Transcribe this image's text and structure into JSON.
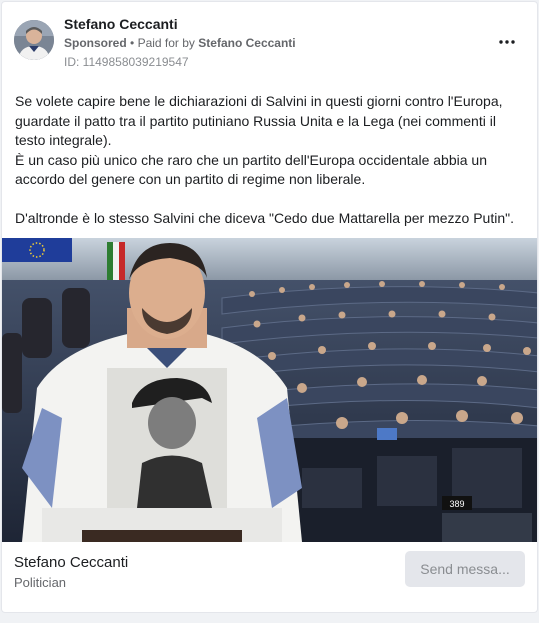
{
  "post": {
    "page_name": "Stefano Ceccanti",
    "sponsored": "Sponsored",
    "separator": "•",
    "paid_for_by_prefix": "Paid for by",
    "paid_for_by_name": "Stefano Ceccanti",
    "ad_id": "ID: 1149858039219547",
    "more_icon": "more-horizontal-icon",
    "body": [
      "Se volete capire bene le dichiarazioni di Salvini in questi giorni contro l'Europa, guardate il patto tra il partito putiniano Russia Unita e la Lega (nei commenti il testo integrale).",
      "È un caso più unico che raro che un partito dell'Europa occidentale abbia un accordo del genere con un partito di regime non liberale.",
      "D'altronde è lo stesso Salvini che diceva \"Cedo due Mattarella per mezzo Putin\"."
    ],
    "photo_seat_number": "389"
  },
  "footer": {
    "name": "Stefano Ceccanti",
    "role": "Politician",
    "send_button_label": "Send messa..."
  },
  "colors": {
    "card_bg": "#ffffff",
    "page_bg": "#f0f2f5",
    "text_primary": "#1c1e21",
    "text_secondary": "#65676b",
    "button_bg": "#e4e6eb"
  }
}
